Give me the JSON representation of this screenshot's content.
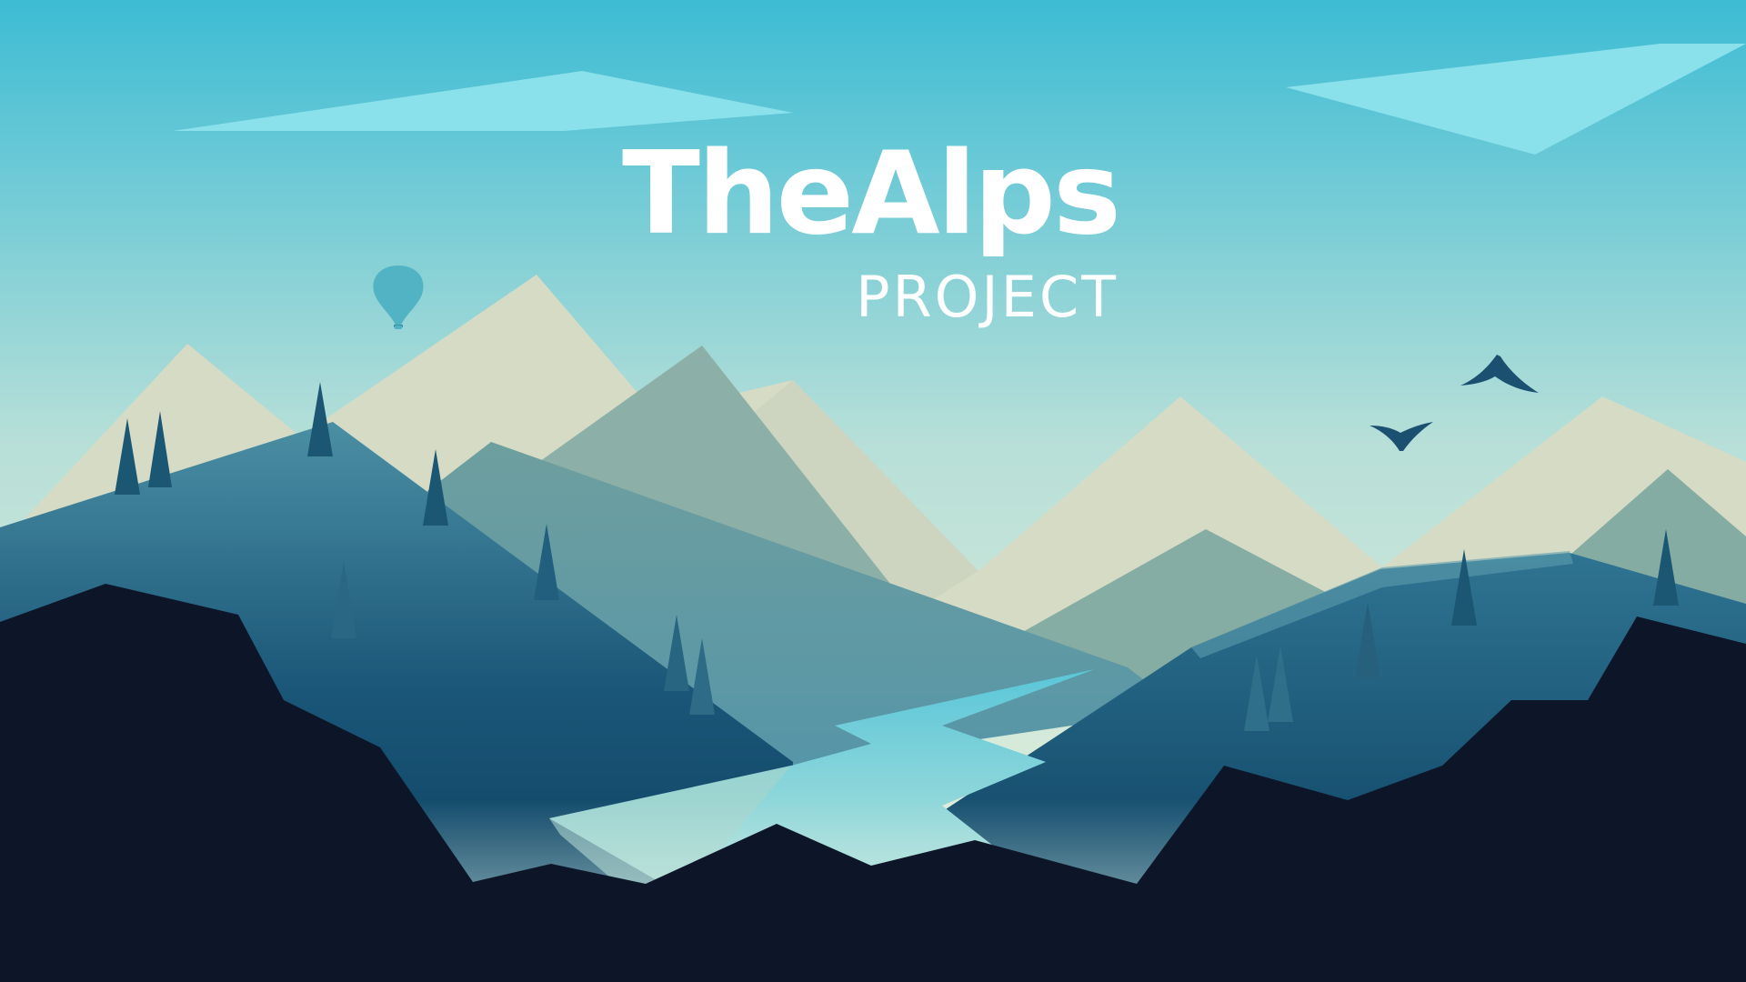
{
  "title": {
    "main": "TheAlps",
    "sub": "PROJECT"
  },
  "icons": {
    "balloon": "hot-air-balloon-icon",
    "bird": "bird-icon"
  },
  "palette": {
    "sky_top": "#3dbcd4",
    "sky_horizon": "#eef2dc",
    "cloud": "#8ae1ec",
    "mountain_far": "#d7dcc7",
    "mountain_mid": "#8bafa6",
    "hill_teal": "#3f8499",
    "hill_deep": "#0f4565",
    "foreground": "#0d1629",
    "river": "#6ccbd8",
    "tree": "#1b5673",
    "balloon": "#52b3c5",
    "bird": "#1c5070",
    "text": "#ffffff"
  }
}
